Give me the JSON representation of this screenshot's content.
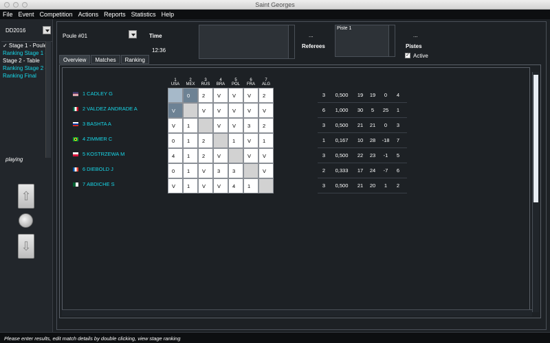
{
  "window": {
    "title": "Saint Georges"
  },
  "menu": [
    "File",
    "Event",
    "Competition",
    "Actions",
    "Reports",
    "Statistics",
    "Help"
  ],
  "left": {
    "event": "DD2016",
    "stages": [
      {
        "label": "✓ Stage 1 - Poule",
        "cyan": false
      },
      {
        "label": "Ranking Stage 1 -",
        "cyan": true
      },
      {
        "label": "Stage 2 - Table",
        "cyan": false
      },
      {
        "label": "Ranking Stage 2 -",
        "cyan": true
      },
      {
        "label": "Ranking Final",
        "cyan": true
      }
    ],
    "status_label": "playing",
    "up_icon": "arrow-up-icon",
    "down_icon": "arrow-down-icon"
  },
  "header": {
    "poule": "Poule #01",
    "time_label": "Time",
    "time_value": "12:36",
    "referees_dots": "...",
    "referees_label": "Referees",
    "piste_item": "Piste 1",
    "pistes_dots": "...",
    "pistes_label": "Pistes",
    "active_label": "Active",
    "active_checked": true
  },
  "tabs": [
    "Overview",
    "Matches",
    "Ranking"
  ],
  "matrix": {
    "columns": [
      {
        "n": "1",
        "c": "USA"
      },
      {
        "n": "2",
        "c": "MEX"
      },
      {
        "n": "3",
        "c": "RUS"
      },
      {
        "n": "4",
        "c": "BRA"
      },
      {
        "n": "5",
        "c": "POL"
      },
      {
        "n": "6",
        "c": "FRA"
      },
      {
        "n": "7",
        "c": "ALG"
      }
    ],
    "fencers": [
      {
        "num": "1",
        "name": "CADLEY G",
        "flag": "usa"
      },
      {
        "num": "2",
        "name": "VALDEZ ANDRADE A",
        "flag": "mex"
      },
      {
        "num": "3",
        "name": "BASHTA A",
        "flag": "rus"
      },
      {
        "num": "4",
        "name": "ZIMMER C",
        "flag": "bra"
      },
      {
        "num": "5",
        "name": "KOSTRZEWA M",
        "flag": "pol"
      },
      {
        "num": "6",
        "name": "DIEBOLD J",
        "flag": "fra"
      },
      {
        "num": "7",
        "name": "ABDICHE S",
        "flag": "alg"
      }
    ],
    "scores": [
      [
        "",
        "0",
        "2",
        "V",
        "V",
        "V",
        "2"
      ],
      [
        "V",
        "",
        "V",
        "V",
        "V",
        "V",
        "V"
      ],
      [
        "V",
        "1",
        "",
        "V",
        "V",
        "3",
        "2"
      ],
      [
        "0",
        "1",
        "2",
        "",
        "1",
        "V",
        "1"
      ],
      [
        "4",
        "1",
        "2",
        "V",
        "",
        "V",
        "V"
      ],
      [
        "0",
        "1",
        "V",
        "3",
        "3",
        "",
        "V"
      ],
      [
        "V",
        "1",
        "V",
        "V",
        "4",
        "1",
        ""
      ]
    ],
    "stats": [
      [
        "3",
        "0,500",
        "19",
        "19",
        "0",
        "4"
      ],
      [
        "6",
        "1,000",
        "30",
        "5",
        "25",
        "1"
      ],
      [
        "3",
        "0,500",
        "21",
        "21",
        "0",
        "3"
      ],
      [
        "1",
        "0,167",
        "10",
        "28",
        "-18",
        "7"
      ],
      [
        "3",
        "0,500",
        "22",
        "23",
        "-1",
        "5"
      ],
      [
        "2",
        "0,333",
        "17",
        "24",
        "-7",
        "6"
      ],
      [
        "3",
        "0,500",
        "21",
        "20",
        "1",
        "2"
      ]
    ]
  },
  "status": "Please enter results, edit match details by double clicking, view stage ranking"
}
